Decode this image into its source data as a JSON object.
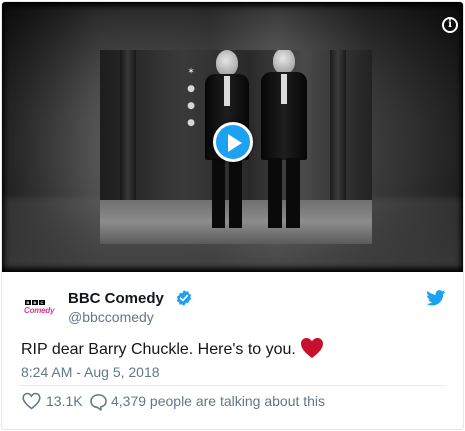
{
  "video": {
    "play_icon": "play-icon",
    "info_icon": "info-icon",
    "info_glyph": "i"
  },
  "account": {
    "avatar_logo": "BBC",
    "avatar_word": "Comedy",
    "name": "BBC Comedy",
    "handle": "@bbccomedy",
    "verified": true
  },
  "tweet": {
    "text": "RIP dear Barry Chuckle. Here's to you.",
    "emoji": "red-heart",
    "timestamp": "8:24 AM - Aug 5, 2018"
  },
  "actions": {
    "likes": "13.1K",
    "talking": "4,379 people are talking about this"
  },
  "colors": {
    "twitter_blue": "#1da1f2",
    "heart_red": "#c8102e",
    "muted_text": "#657786",
    "brand_pink": "#d63c8c"
  }
}
